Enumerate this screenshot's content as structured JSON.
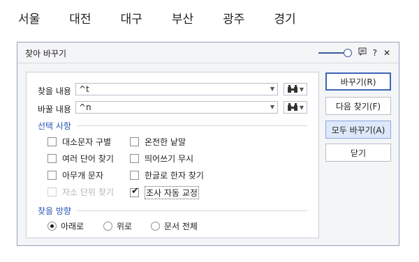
{
  "doc_words": [
    "서울",
    "대전",
    "대구",
    "부산",
    "광주",
    "경기"
  ],
  "dialog": {
    "title": "찾아 바꾸기",
    "icons": [
      "slider-icon",
      "comment-icon",
      "help-icon",
      "close-icon"
    ],
    "help_glyph": "?",
    "close_glyph": "✕",
    "find_label": "찾을 내용",
    "find_value": "^t",
    "replace_label": "바꿀 내용",
    "replace_value": "^n",
    "options_title": "선택 사항",
    "options": [
      {
        "label": "대소문자 구별",
        "checked": false,
        "disabled": false
      },
      {
        "label": "온전한 낱말",
        "checked": false,
        "disabled": false
      },
      {
        "label": "여러 단어 찾기",
        "checked": false,
        "disabled": false
      },
      {
        "label": "띄어쓰기 무시",
        "checked": false,
        "disabled": false
      },
      {
        "label": "아무개 문자",
        "checked": false,
        "disabled": false
      },
      {
        "label": "한글로 한자 찾기",
        "checked": false,
        "disabled": false
      },
      {
        "label": "자소 단위 찾기",
        "checked": false,
        "disabled": true
      },
      {
        "label": "조사 자동 교정",
        "checked": true,
        "disabled": false
      }
    ],
    "direction_title": "찾을 방향",
    "directions": [
      {
        "label": "아래로",
        "selected": true
      },
      {
        "label": "위로",
        "selected": false
      },
      {
        "label": "문서 전체",
        "selected": false
      }
    ],
    "buttons": {
      "replace": "바꾸기(R)",
      "find_next": "다음 찾기(F)",
      "replace_all": "모두 바꾸기(A)",
      "close": "닫기"
    }
  }
}
